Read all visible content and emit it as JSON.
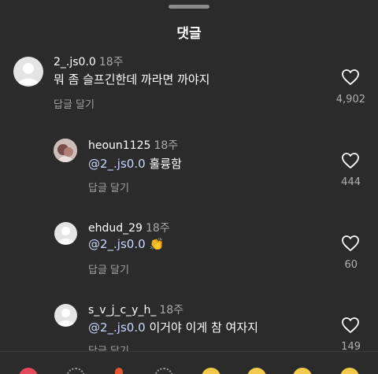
{
  "header": {
    "title": "댓글"
  },
  "comments": [
    {
      "username": "2_.js0.0",
      "time": "18주",
      "mention": "",
      "text": "뭐 좀 슬프긴한데 까라면 까야지",
      "reply_label": "답글 달기",
      "likes": "4,902"
    },
    {
      "username": "heoun1125",
      "time": "18주",
      "mention": "@2_.js0.0",
      "text": "훌륭함",
      "reply_label": "답글 달기",
      "likes": "444"
    },
    {
      "username": "ehdud_29",
      "time": "18주",
      "mention": "@2_.js0.0",
      "text": "👏",
      "reply_label": "답글 달기",
      "likes": "60"
    },
    {
      "username": "s_v_j_c_y_h_",
      "time": "18주",
      "mention": "@2_.js0.0",
      "text": "이거야 이게 참 여자지",
      "reply_label": "답글 달기",
      "likes": "149"
    }
  ],
  "icons": {
    "like": "heart-outline-icon",
    "avatar_default": "default-avatar-icon"
  },
  "colors": {
    "background": "#2b2b2b",
    "mention": "#c9d6ff",
    "secondary_text": "#a8a8a8"
  }
}
